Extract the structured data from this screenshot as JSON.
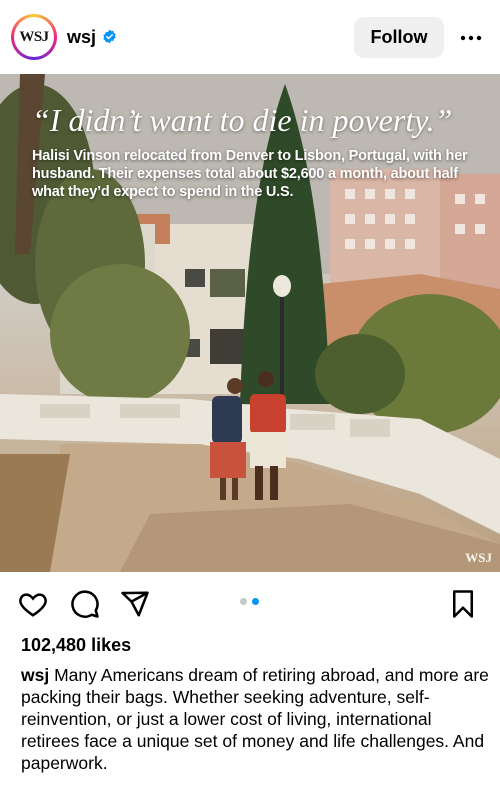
{
  "header": {
    "avatar_text": "WSJ",
    "username": "wsj",
    "follow_label": "Follow",
    "icons": {
      "verified": "verified-badge-icon",
      "more": "more-options-icon"
    }
  },
  "post": {
    "headline": "“I didn’t want to die in poverty.”",
    "subtext": "Halisi Vinson relocated from Denver to Lisbon, Portugal, with her husband. Their expenses total about $2,600 a month, about half what they’d expect to spend in the U.S.",
    "watermark": "WSJ",
    "carousel": {
      "total": 2,
      "active_index": 1
    }
  },
  "actions": {
    "icons": [
      "heart-icon",
      "comment-icon",
      "share-icon",
      "bookmark-icon"
    ]
  },
  "likes_text": "102,480 likes",
  "caption": {
    "username": "wsj",
    "text": "Many Americans dream of retiring abroad, and more are packing their bags. Whether seeking adventure, self-reinvention, or just a lower cost of living, international retirees face a unique set of money and life challenges. And paperwork."
  },
  "colors": {
    "accent_blue": "#0095f6",
    "follow_bg": "#efefef",
    "verified_blue": "#0095f6"
  }
}
